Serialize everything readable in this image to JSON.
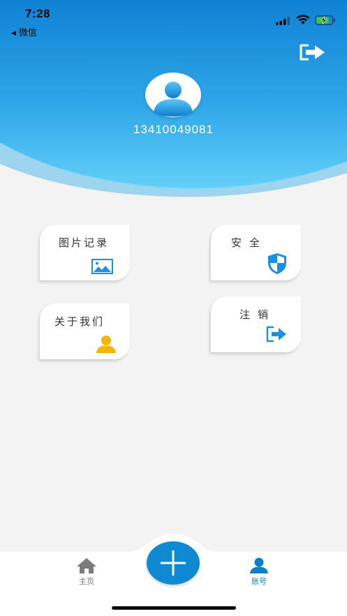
{
  "status_bar": {
    "time": "7:28",
    "back_app": "微信"
  },
  "header": {
    "phone": "13410049081",
    "logout_icon": "logout-arrow-icon",
    "avatar_icon": "user-avatar-icon"
  },
  "cards": {
    "photo": {
      "label": "图片记录",
      "icon": "image-icon",
      "icon_color": "#1d8fe0"
    },
    "security": {
      "label": "安全",
      "icon": "shield-icon",
      "icon_color": "#1d8fe0"
    },
    "about": {
      "label": "关于我们",
      "icon": "person-icon",
      "icon_color": "#f4b400"
    },
    "cancel": {
      "label": "注销",
      "icon": "logout-arrow-icon",
      "icon_color": "#1d8fe0"
    }
  },
  "tabbar": {
    "home_label": "主页",
    "account_label": "账号",
    "add_icon": "plus-icon",
    "active_color": "#0f7fc6",
    "inactive_color": "#777777"
  },
  "theme": {
    "header_top": "#1185d6",
    "header_bottom": "#5ccbf7",
    "background": "#f3f3f3"
  }
}
